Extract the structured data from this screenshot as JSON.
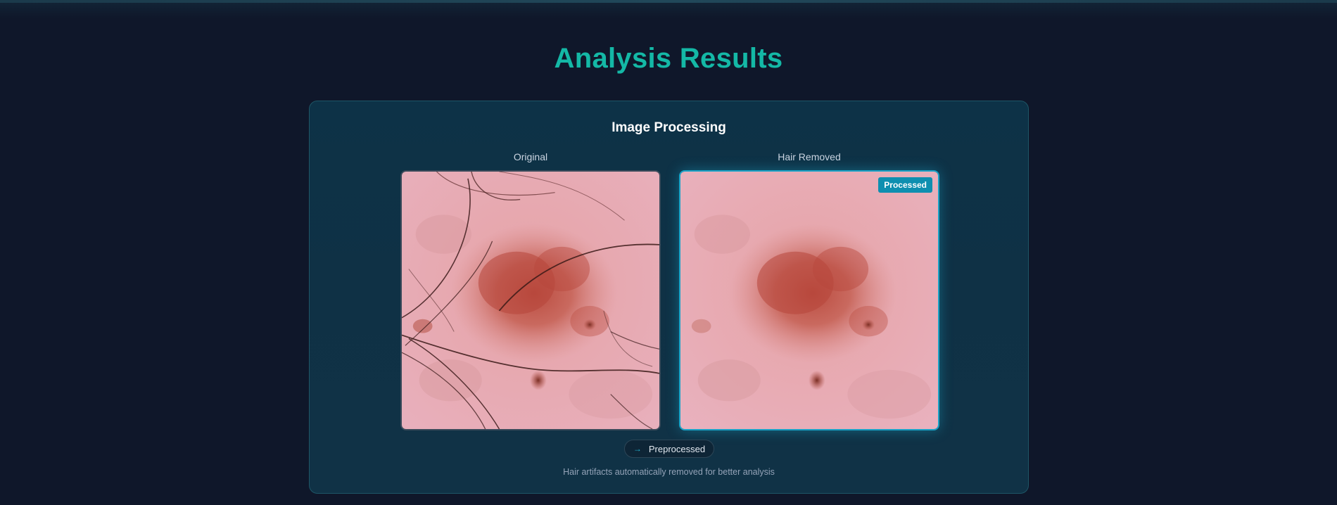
{
  "page": {
    "title": "Analysis Results"
  },
  "card": {
    "title": "Image Processing",
    "original_label": "Original",
    "processed_label": "Hair Removed",
    "badge": "Processed",
    "pill_label": "Preprocessed",
    "pill_icon": "arrow-right-icon",
    "caption": "Hair artifacts automatically removed for better analysis"
  },
  "colors": {
    "background": "#0f172a",
    "accent_teal": "#14b8a6",
    "accent_cyan": "#1aa3c7",
    "badge": "#0e8fb0"
  }
}
